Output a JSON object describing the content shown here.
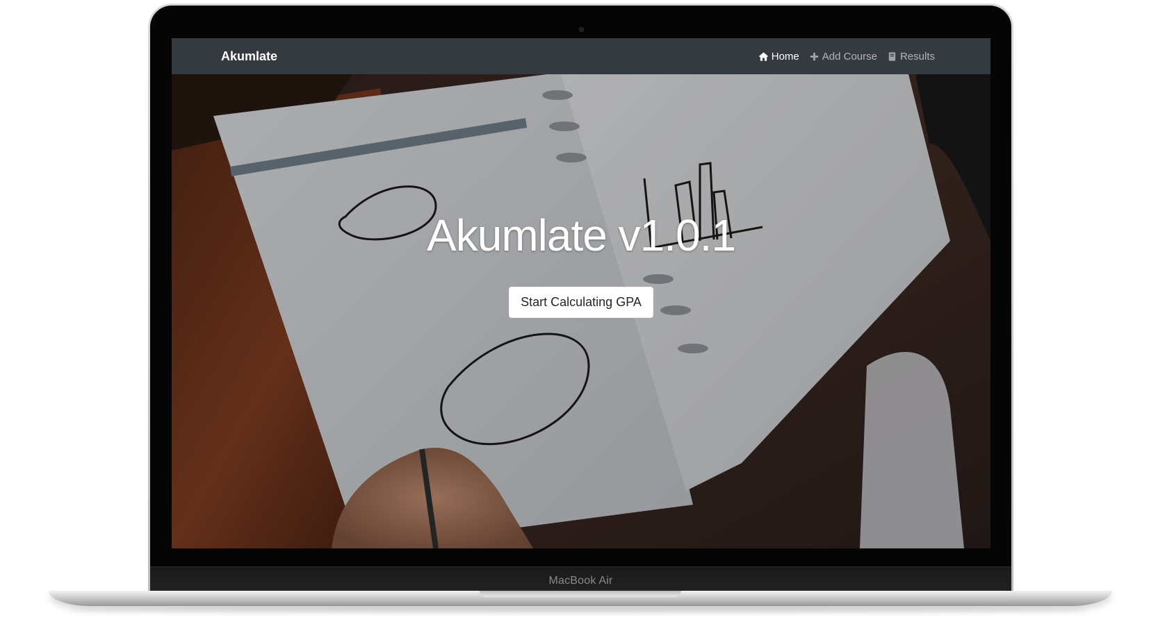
{
  "device": {
    "label": "MacBook Air"
  },
  "navbar": {
    "brand": "Akumlate",
    "links": [
      {
        "label": "Home",
        "icon": "home-icon",
        "active": true
      },
      {
        "label": "Add Course",
        "icon": "plus-icon",
        "active": false
      },
      {
        "label": "Results",
        "icon": "book-icon",
        "active": false
      }
    ]
  },
  "hero": {
    "title": "Akumlate v1.0.1",
    "cta_label": "Start Calculating GPA",
    "background_image": "notebook-photo"
  },
  "colors": {
    "navbar_bg": "#343a40",
    "nav_active": "#ffffff",
    "nav_inactive": "#a1a4a8",
    "button_bg": "#ffffff"
  }
}
